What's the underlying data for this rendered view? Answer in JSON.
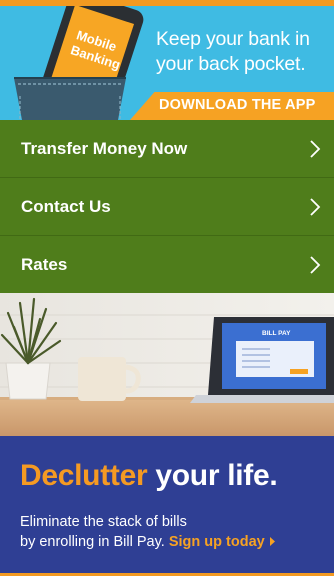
{
  "colors": {
    "accent_orange": "#f39a21",
    "banner_blue": "#3fbbe3",
    "nav_green": "#4f7d1b",
    "promo_navy": "#2f3f94"
  },
  "app_banner": {
    "phone_screen_text": [
      "Mobile",
      "Banking"
    ],
    "headline": [
      "Keep your bank in",
      "your back pocket."
    ],
    "cta_label": "DOWNLOAD THE APP"
  },
  "nav": {
    "items": [
      {
        "label": "Transfer Money Now",
        "icon": "chevron-right-icon"
      },
      {
        "label": "Contact Us",
        "icon": "chevron-right-icon"
      },
      {
        "label": "Rates",
        "icon": "chevron-right-icon"
      }
    ]
  },
  "desk_photo": {
    "laptop_screen_title": "BILL PAY"
  },
  "promo": {
    "title_accent": "Declutter",
    "title_rest": " your life.",
    "body_line1": "Eliminate the stack of bills",
    "body_line2": "by enrolling in Bill Pay.",
    "link_label": "Sign up today",
    "link_icon": "caret-right-icon"
  }
}
